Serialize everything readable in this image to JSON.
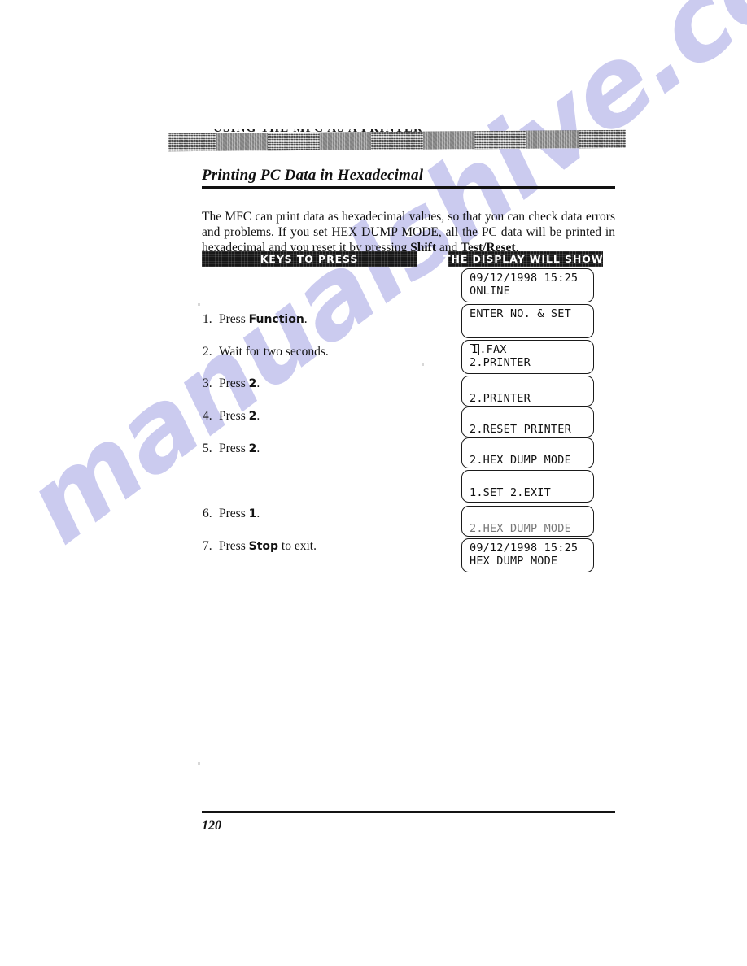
{
  "document": {
    "running_header": "USING THE MFC AS A PRINTER",
    "section_heading": "Printing PC Data in Hexadecimal",
    "page_number": "120"
  },
  "intro": {
    "part1": "The MFC can print data as hexadecimal values, so that you can check data errors and problems. If you set HEX DUMP MODE, all the PC data will be printed in hexadecimal and you reset it by pressing ",
    "bold1": "Shift",
    "part2": " and ",
    "bold2": "Test/Reset",
    "part3": "."
  },
  "columns": {
    "keys_header": "KEYS TO PRESS",
    "display_header": "THE DISPLAY WILL SHOW:"
  },
  "steps": [
    {
      "num": "1.",
      "pre": "Press ",
      "key": "Function",
      "post": "."
    },
    {
      "num": "2.",
      "pre": "Wait for two seconds.",
      "key": "",
      "post": ""
    },
    {
      "num": "3.",
      "pre": "Press ",
      "key": "2",
      "post": "."
    },
    {
      "num": "4.",
      "pre": "Press ",
      "key": "2",
      "post": "."
    },
    {
      "num": "5.",
      "pre": "Press ",
      "key": "2",
      "post": "."
    },
    {
      "num": "6.",
      "pre": "Press ",
      "key": "1",
      "post": "."
    },
    {
      "num": "7.",
      "pre": "Press ",
      "key": "Stop",
      "post": " to exit."
    }
  ],
  "displays": [
    {
      "line1": "09/12/1998 15:25",
      "line2": "ONLINE",
      "line1_cursor": "",
      "faded": false
    },
    {
      "line1": "ENTER NO. & SET",
      "line2": "",
      "line1_cursor": "",
      "faded": false
    },
    {
      "line1": "1.FAX",
      "line2": "2.PRINTER",
      "line1_cursor": "1",
      "faded": false
    },
    {
      "line1": "",
      "line2": "2.PRINTER",
      "line1_cursor": "",
      "faded": false
    },
    {
      "line1": "",
      "line2": "2.RESET PRINTER",
      "line1_cursor": "",
      "faded": false
    },
    {
      "line1": "",
      "line2": "2.HEX DUMP MODE",
      "line1_cursor": "",
      "faded": false
    },
    {
      "line1": "",
      "line2": "1.SET 2.EXIT",
      "line1_cursor": "",
      "faded": false
    },
    {
      "line1": "",
      "line2": "2.HEX DUMP MODE",
      "line1_cursor": "",
      "faded": true
    },
    {
      "line1": "09/12/1998 15:25",
      "line2": "HEX DUMP MODE",
      "line1_cursor": "",
      "faded": false
    }
  ],
  "watermark": {
    "text": "manualshive.com",
    "color": "#c9c9ef"
  }
}
